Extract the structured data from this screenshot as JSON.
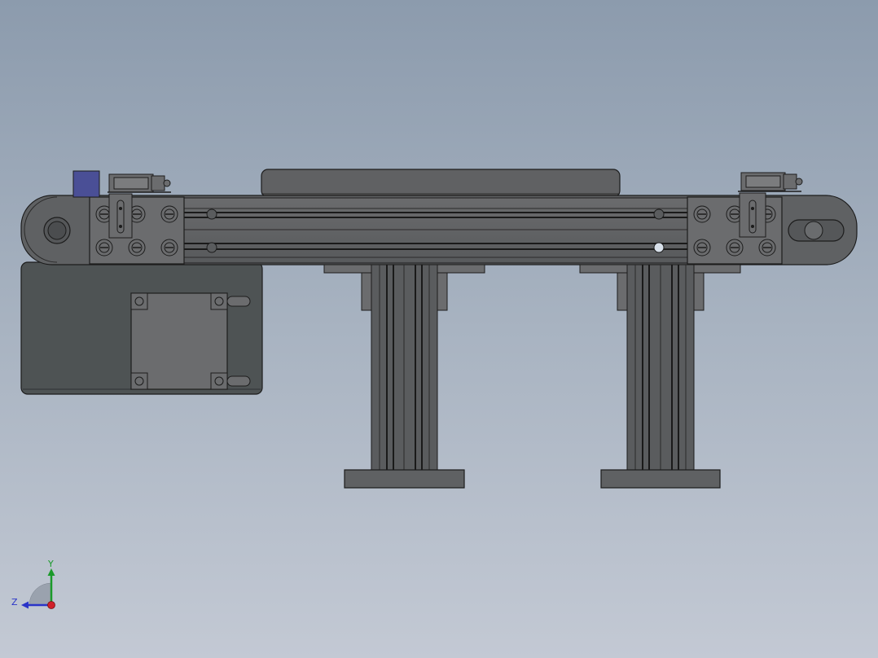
{
  "view": {
    "background_top": "#8c9bad",
    "background_bottom": "#c3c9d4"
  },
  "model": {
    "body_color": "#5f6163",
    "plate_color": "#6b6c6e",
    "motor_housing_color": "#4e5354",
    "edge_color": "#1c1c1c",
    "sensor_block_color": "#4a4f96"
  },
  "triad": {
    "y_label": "Y",
    "z_label": "Z",
    "y_color": "#1a9a2a",
    "z_color": "#2a34c8",
    "x_color": "#d0202a"
  }
}
